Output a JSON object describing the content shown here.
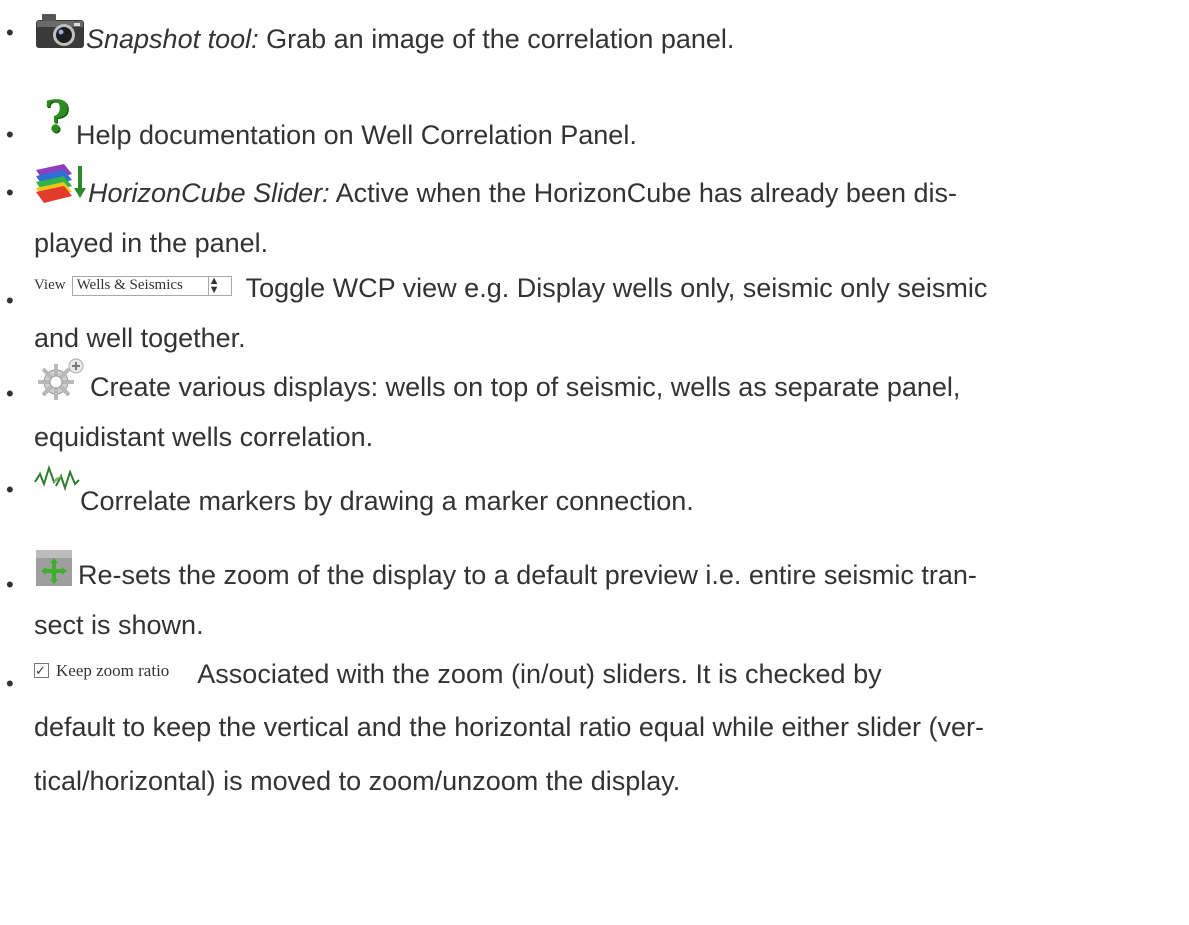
{
  "bullet_char": "•",
  "items": [
    {
      "icon": "snapshot-camera-icon",
      "lead": "Snapshot tool:",
      "text": " Grab an image of the correlation panel."
    },
    {
      "icon": "help-question-icon",
      "text": "Help documentation on Well Correlation Panel."
    },
    {
      "icon": "horizoncube-slider-icon",
      "lead": "HorizonCube Slider:",
      "text_line1": " Active when the HorizonCube has already been dis-",
      "text_line2": "played in the panel."
    },
    {
      "control": {
        "label": "View",
        "value": "Wells & Seismics",
        "arrow": "▲▼"
      },
      "text_line1": "Toggle WCP view e.g. Display wells only, seismic only seismic",
      "text_line2": "and well together."
    },
    {
      "icon": "create-displays-gear-icon",
      "text_line1": "Create various displays: wells on top of seismic, wells as separate panel,",
      "text_line2": "equidistant wells correlation."
    },
    {
      "icon": "correlate-markers-icon",
      "text": "Correlate markers by drawing a marker connection."
    },
    {
      "icon": "reset-zoom-icon",
      "text_line1": "Re-sets the zoom of the display to a default preview i.e. entire seismic tran-",
      "text_line2": "sect is shown."
    },
    {
      "control": {
        "check": "✓",
        "label": "Keep zoom ratio"
      },
      "text_line1": "Associated with the zoom (in/out) sliders. It is checked by",
      "text_line2": "default to keep the vertical and the horizontal ratio equal while either slider (ver-",
      "text_line3": "tical/horizontal) is moved to zoom/unzoom the display."
    }
  ],
  "colors": {
    "text": "#333333",
    "help_green": "#2e8b1f"
  }
}
